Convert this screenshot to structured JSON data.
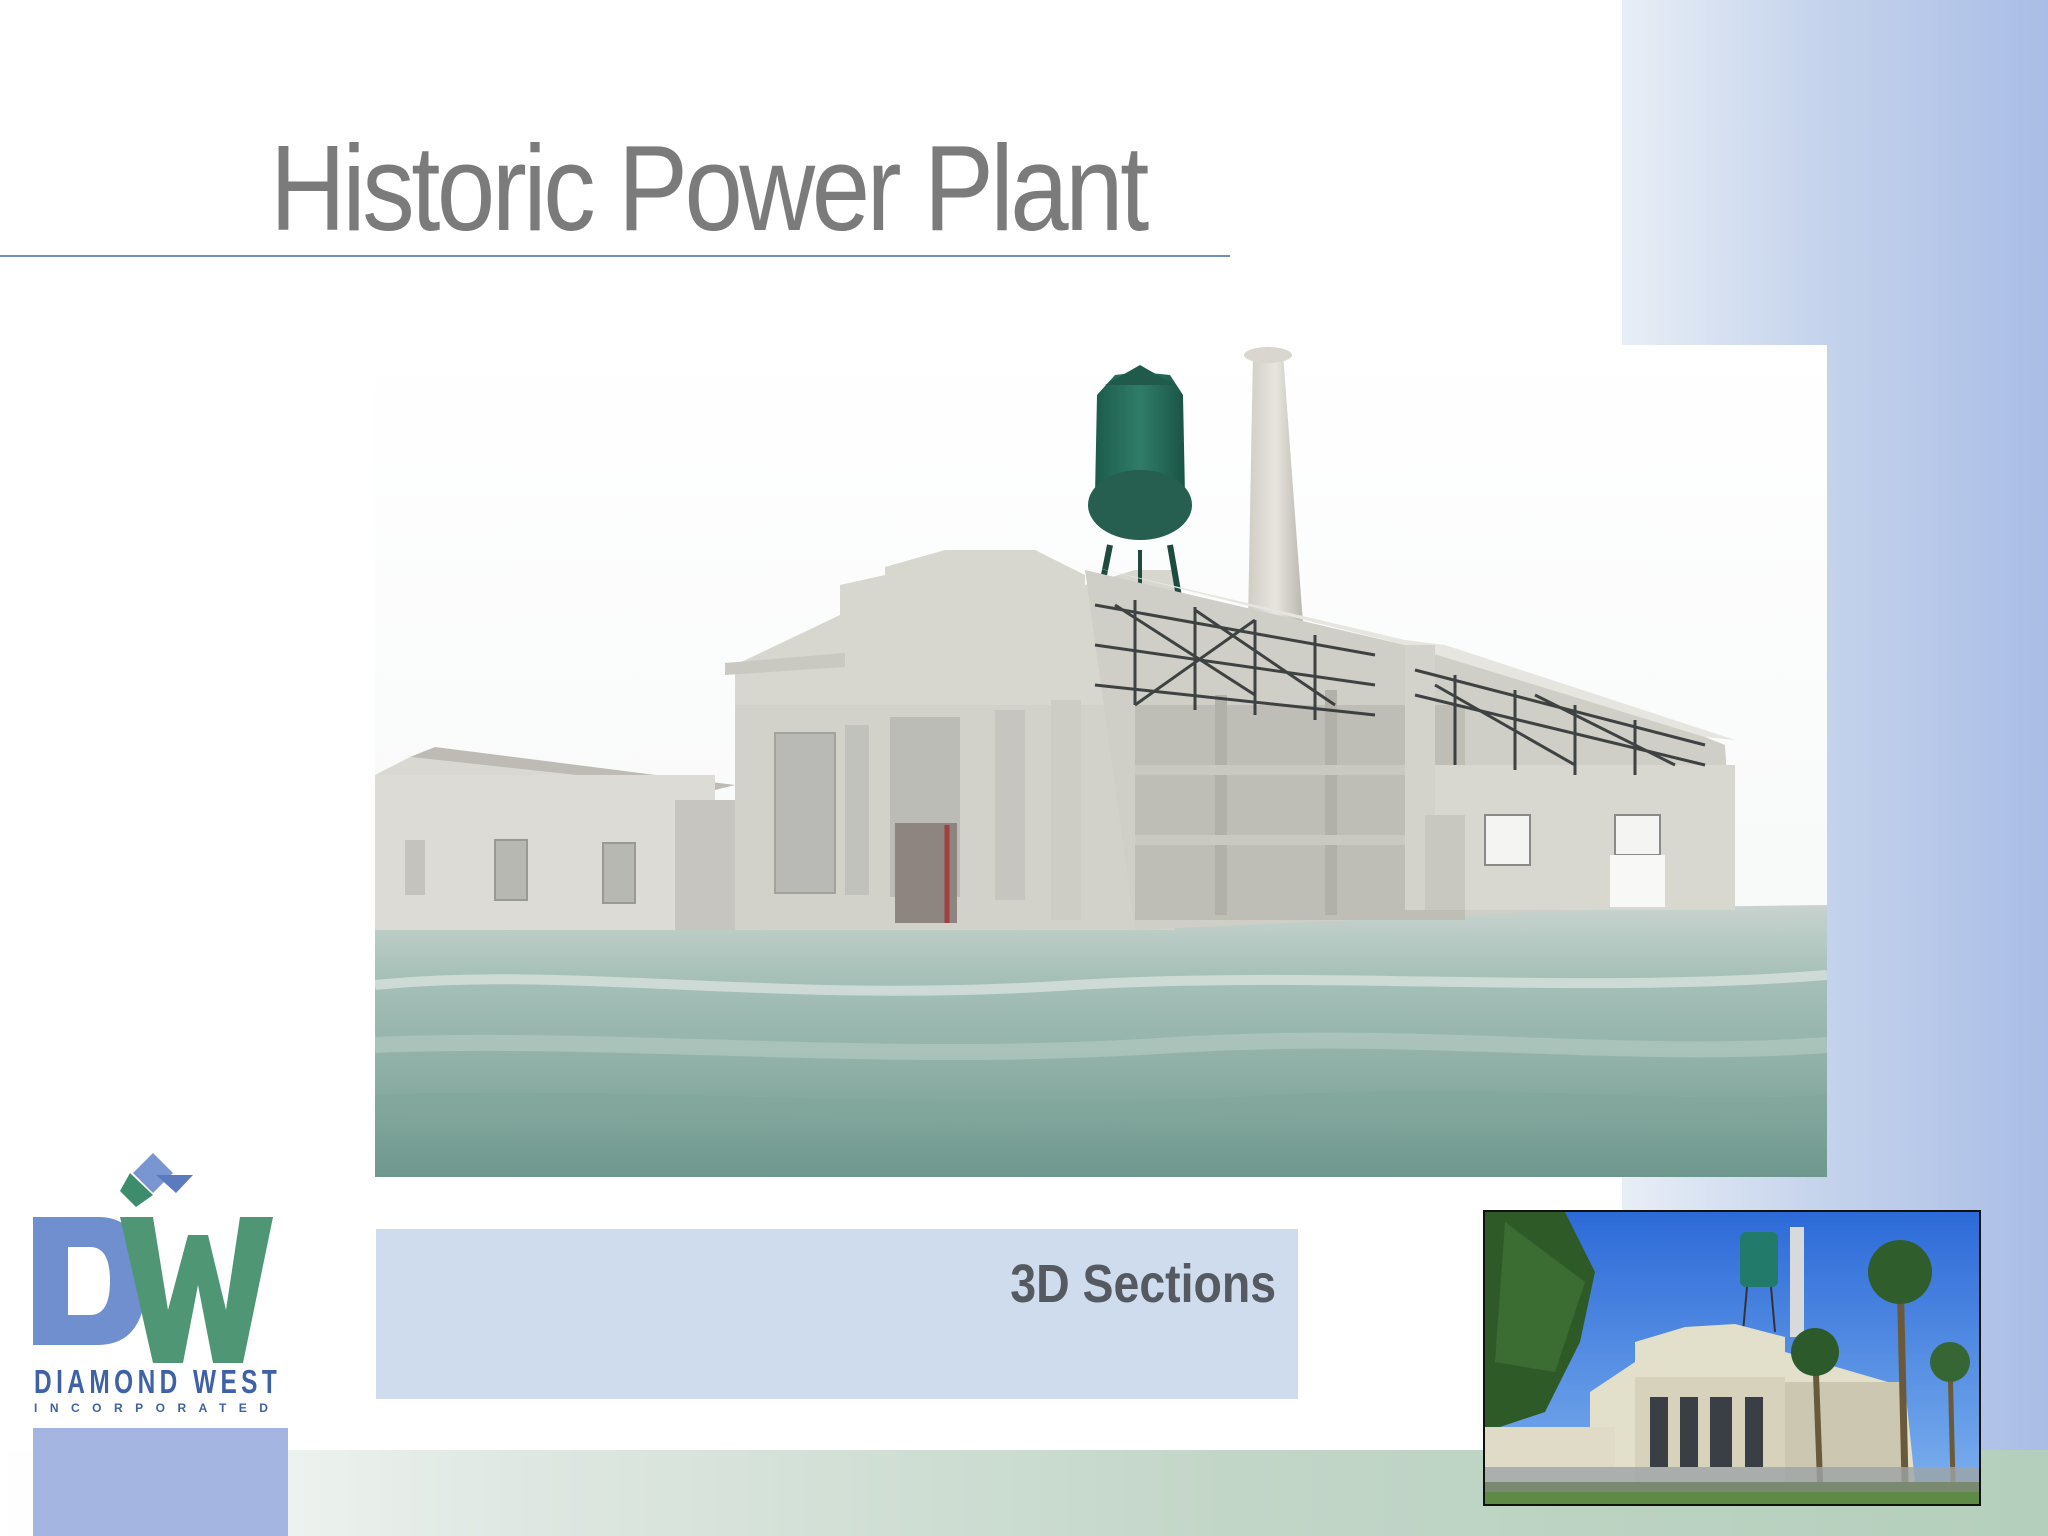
{
  "slide": {
    "title": "Historic Power Plant",
    "caption": "3D Sections"
  },
  "logo": {
    "letters": "DW",
    "name": "DIAMOND WEST",
    "subtitle": "INCORPORATED"
  },
  "colors": {
    "title_text": "#7b7b7b",
    "rule": "#6f8fb3",
    "caption_box": "#cfdcee",
    "logo_blue": "#6f8fce",
    "logo_green": "#4f9674",
    "right_band": "#a9bde6"
  }
}
